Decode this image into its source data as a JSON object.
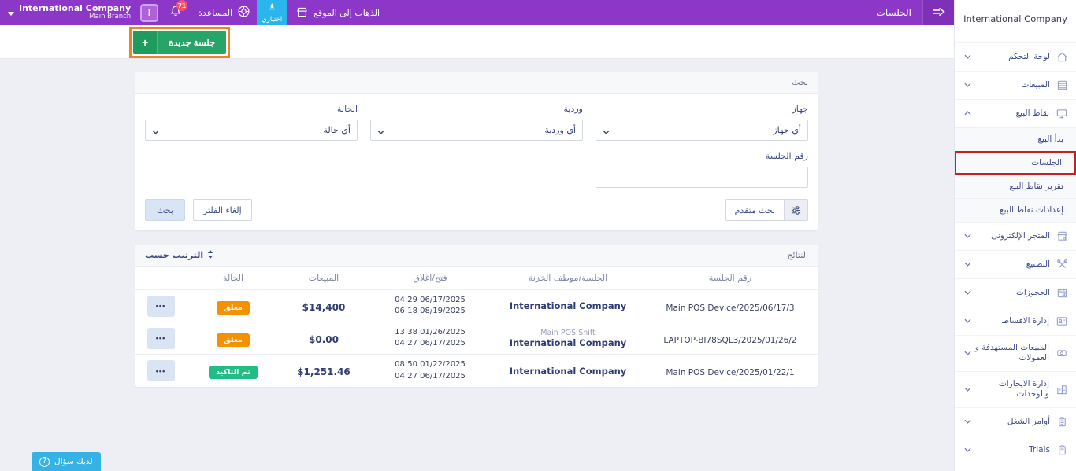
{
  "topbar": {
    "title": "الجلسات",
    "company_selector": {
      "company": "International Company",
      "branch": "Main Branch"
    },
    "avatar_letter": "I",
    "notifications_count": "71",
    "help_label": "المساعدة",
    "trial_button_label": "اختياري",
    "go_to_site_label": "الذهاب إلى الموقع"
  },
  "actions": {
    "new_session_label": "جلسة جديدة",
    "plus_sign": "+"
  },
  "sidebar": {
    "company_name": "International Company",
    "items": [
      {
        "type": "parent",
        "label": "لوحة التحكم",
        "icon": "home-icon",
        "chevron": "down"
      },
      {
        "type": "parent",
        "label": "المبيعات",
        "icon": "sales-icon",
        "chevron": "down"
      },
      {
        "type": "parent",
        "label": "نقاط البيع",
        "icon": "pos-icon",
        "chevron": "up"
      },
      {
        "type": "sub",
        "label": "بدأ البيع"
      },
      {
        "type": "sub",
        "label": "الجلسات",
        "highlighted": true
      },
      {
        "type": "sub",
        "label": "تقرير نقاط البيع"
      },
      {
        "type": "sub",
        "label": "إعدادات نقاط البيع"
      },
      {
        "type": "parent",
        "label": "المتجر الإلكترونى",
        "icon": "store-icon",
        "chevron": "down"
      },
      {
        "type": "parent",
        "label": "التصنيع",
        "icon": "manufacturing-icon",
        "chevron": "down"
      },
      {
        "type": "parent",
        "label": "الحجوزات",
        "icon": "reservations-icon",
        "chevron": "down"
      },
      {
        "type": "parent",
        "label": "إدارة الاقساط",
        "icon": "installments-icon",
        "chevron": "down"
      },
      {
        "type": "parent",
        "label": "المبيعات المستهدفة و العمولات",
        "icon": "commissions-icon",
        "chevron": "down",
        "tall": true
      },
      {
        "type": "parent",
        "label": "إدارة الايجارات والوحدات",
        "icon": "rentals-icon",
        "chevron": "down",
        "tall": true
      },
      {
        "type": "parent",
        "label": "أوامر الشغل",
        "icon": "work-orders-icon",
        "chevron": "down"
      },
      {
        "type": "parent",
        "label": "Trials",
        "icon": "trials-icon",
        "chevron": "down"
      }
    ]
  },
  "search_panel": {
    "title": "بحث",
    "device_label": "جهاز",
    "device_value": "أي جهاز",
    "shift_label": "وردية",
    "shift_value": "أي وردية",
    "status_label": "الحالة",
    "status_value": "أي حالة",
    "session_number_label": "رقم الجلسة",
    "session_number_value": "",
    "advanced_search_label": "بحث متقدم",
    "clear_filter_label": "إلغاء الفلتر",
    "search_button_label": "بحث"
  },
  "results_panel": {
    "title": "النتائج",
    "sort_label": "الترتيب حسب",
    "columns": [
      "رقم الجلسة",
      "الجلسة/موظف الخزنة",
      "فتح/اغلاق",
      "المبيعات",
      "الحالة",
      ""
    ],
    "rows": [
      {
        "session_number": "Main POS Device/2025/06/17/3",
        "shift_name": "",
        "cashier": "International Company",
        "opened": "04:29 06/17/2025",
        "closed": "06:18 08/19/2025",
        "sales": "$14,400",
        "status": "مغلق",
        "status_type": "closed"
      },
      {
        "session_number": "LAPTOP-BI78SQL3/2025/01/26/2",
        "shift_name": "Main POS Shift",
        "cashier": "International Company",
        "opened": "13:38 01/26/2025",
        "closed": "04:27 06/17/2025",
        "sales": "$0.00",
        "status": "مغلق",
        "status_type": "closed"
      },
      {
        "session_number": "Main POS Device/2025/01/22/1",
        "shift_name": "",
        "cashier": "International Company",
        "opened": "08:50 01/22/2025",
        "closed": "04:27 06/17/2025",
        "sales": "$1,251.46",
        "status": "تم التاكيد",
        "status_type": "confirmed"
      }
    ],
    "actions_dots": "•••"
  },
  "footer": {
    "question_label": "لديك سؤال",
    "question_mark": "?"
  },
  "colors": {
    "topbar_purple": "#8d37c8",
    "accent_cyan": "#2ab6ea",
    "success_green": "#27a468",
    "status_closed_orange": "#f59100",
    "status_confirmed_green": "#21bd84",
    "annotation_orange": "#ee8325",
    "annotation_red": "#c6201f"
  }
}
